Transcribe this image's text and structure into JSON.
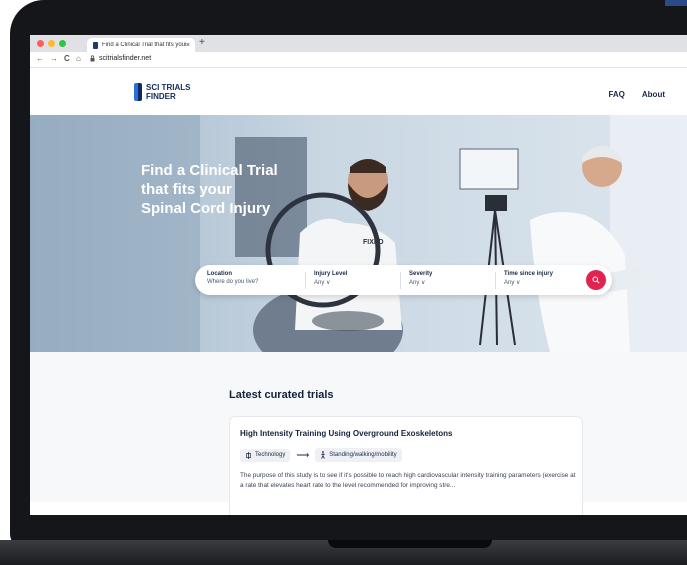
{
  "browser": {
    "tab_title": "Find a Clinical Trial that fits your",
    "tab_close": "×",
    "new_tab": "+",
    "url": "scitrialsfinder.net",
    "nav_back": "←",
    "nav_forward": "→",
    "nav_reload": "C",
    "nav_home": "⌂"
  },
  "site": {
    "logo_line1": "SCI TRIALS",
    "logo_line2": "FINDER",
    "nav": [
      "FAQ",
      "About"
    ]
  },
  "hero": {
    "title_lines": [
      "Find a Clinical Trial",
      "that fits your",
      "Spinal Cord Injury"
    ],
    "shirt_text": "FIXED"
  },
  "search": {
    "fields": [
      {
        "label": "Location",
        "value": "Where do you live?"
      },
      {
        "label": "Injury Level",
        "value": "Any ∨"
      },
      {
        "label": "Severity",
        "value": "Any ∨"
      },
      {
        "label": "Time since injury",
        "value": "Any ∨"
      }
    ]
  },
  "latest": {
    "heading": "Latest curated trials",
    "card": {
      "title": "High Intensity Training Using Overground Exoskeletons",
      "chip1": "Technology",
      "chip_arrow": "⟶",
      "chip2": "Standing/walking/mobility",
      "description": "The purpose of this study is to see if it's possible to reach high cardiovascular intensity training parameters (exercise at a rate that elevates heart rate to the level recommended for improving stre..."
    }
  },
  "colors": {
    "accent": "#e0244f",
    "brand": "#0f2b5c",
    "brand_light": "#2a6fdb",
    "bezel": "#151619"
  }
}
